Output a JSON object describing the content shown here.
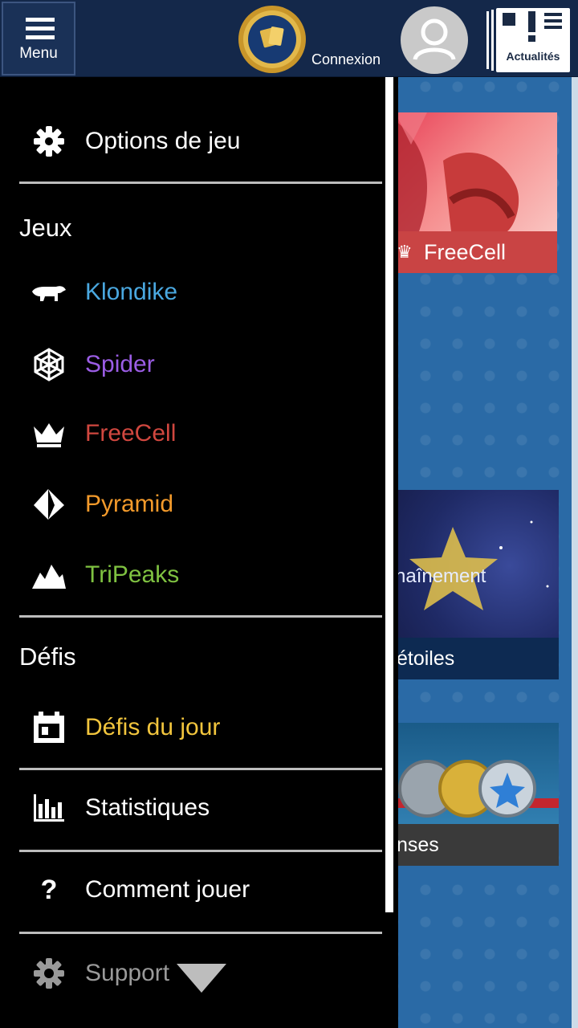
{
  "topbar": {
    "menu_label": "Menu",
    "connexion_label": "Connexion",
    "news_label": "Actualités"
  },
  "background_cards": {
    "card1_label": "FreeCell",
    "card2_text": "haînement",
    "card2_label": "étoiles",
    "card3_label": "nses"
  },
  "drawer": {
    "options_label": "Options de jeu",
    "section_games": "Jeux",
    "games": [
      {
        "label": "Klondike",
        "color": "#4aa8e0",
        "icon": "polar-bear-icon"
      },
      {
        "label": "Spider",
        "color": "#9b5de5",
        "icon": "spider-web-icon"
      },
      {
        "label": "FreeCell",
        "color": "#d0473f",
        "icon": "crown-icon"
      },
      {
        "label": "Pyramid",
        "color": "#f39a2b",
        "icon": "pyramid-icon"
      },
      {
        "label": "TriPeaks",
        "color": "#7fc241",
        "icon": "mountains-icon"
      }
    ],
    "section_challenges": "Défis",
    "daily_label": "Défis du jour",
    "daily_color": "#f2c53d",
    "stats_label": "Statistiques",
    "howto_label": "Comment jouer",
    "howto_icon": "?",
    "support_label": "Support"
  }
}
